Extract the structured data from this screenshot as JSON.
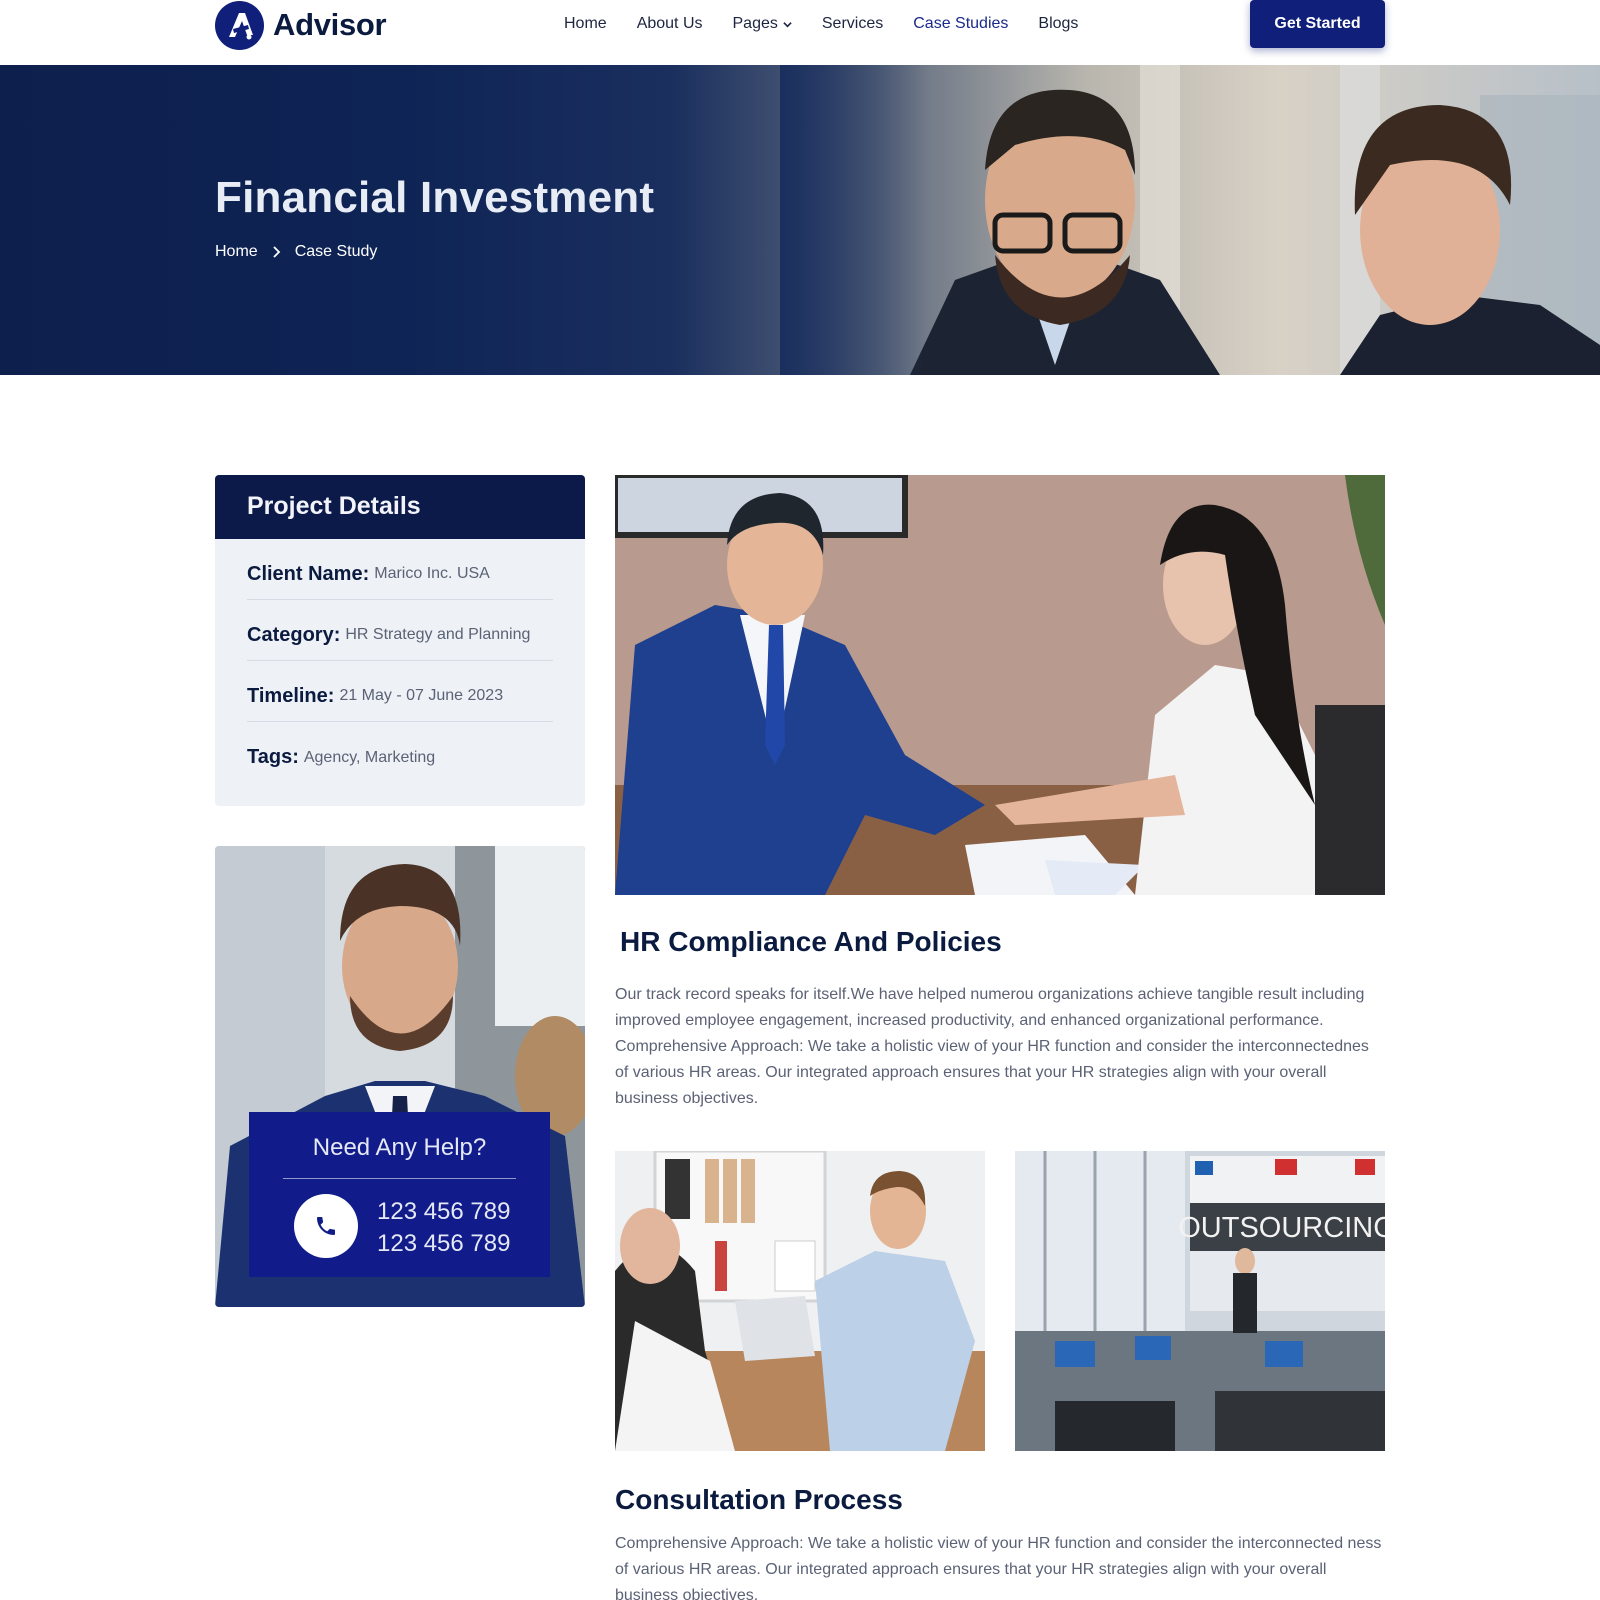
{
  "brand": {
    "name": "Advisor",
    "accent": "#0f1f7a",
    "dark": "#0c1a4a"
  },
  "nav": {
    "items": [
      {
        "label": "Home"
      },
      {
        "label": "About Us"
      },
      {
        "label": "Pages"
      },
      {
        "label": "Services"
      },
      {
        "label": "Case Studies"
      },
      {
        "label": "Blogs"
      }
    ],
    "active": "Case Studies",
    "cta_label": "Get Started"
  },
  "hero": {
    "title": "Financial Investment",
    "breadcrumb": [
      "Home",
      "Case Study"
    ]
  },
  "project_details": {
    "title": "Project Details",
    "rows": [
      {
        "label": "Client Name:",
        "value": "Marico Inc. USA"
      },
      {
        "label": "Category:",
        "value": "HR Strategy and Planning"
      },
      {
        "label": "Timeline:",
        "value": "21 May - 07 June 2023"
      },
      {
        "label": "Tags:",
        "value": "Agency, Marketing"
      }
    ]
  },
  "help": {
    "title": "Need Any Help?",
    "phones": [
      "123 456 789",
      "123 456 789"
    ]
  },
  "main": {
    "section1_title": "HR Compliance And Policies",
    "section1_text": " Our track record speaks for itself.We have helped numerou organizations achieve tangible result including improved employee engagement, increased productivity, and enhanced organizational performance. Comprehensive Approach: We take a holistic view of your HR function and consider the interconnectednes of various HR areas. Our integrated approach ensures that your HR strategies align with your overall business objectives.",
    "outsourcing_sign": "OUTSOURCING",
    "section2_title": "Consultation Process",
    "section2_text": "Comprehensive Approach: We take a holistic view of your HR function and consider the interconnected ness of various HR areas. Our integrated approach ensures that your HR strategies align with your overall business objectives."
  }
}
